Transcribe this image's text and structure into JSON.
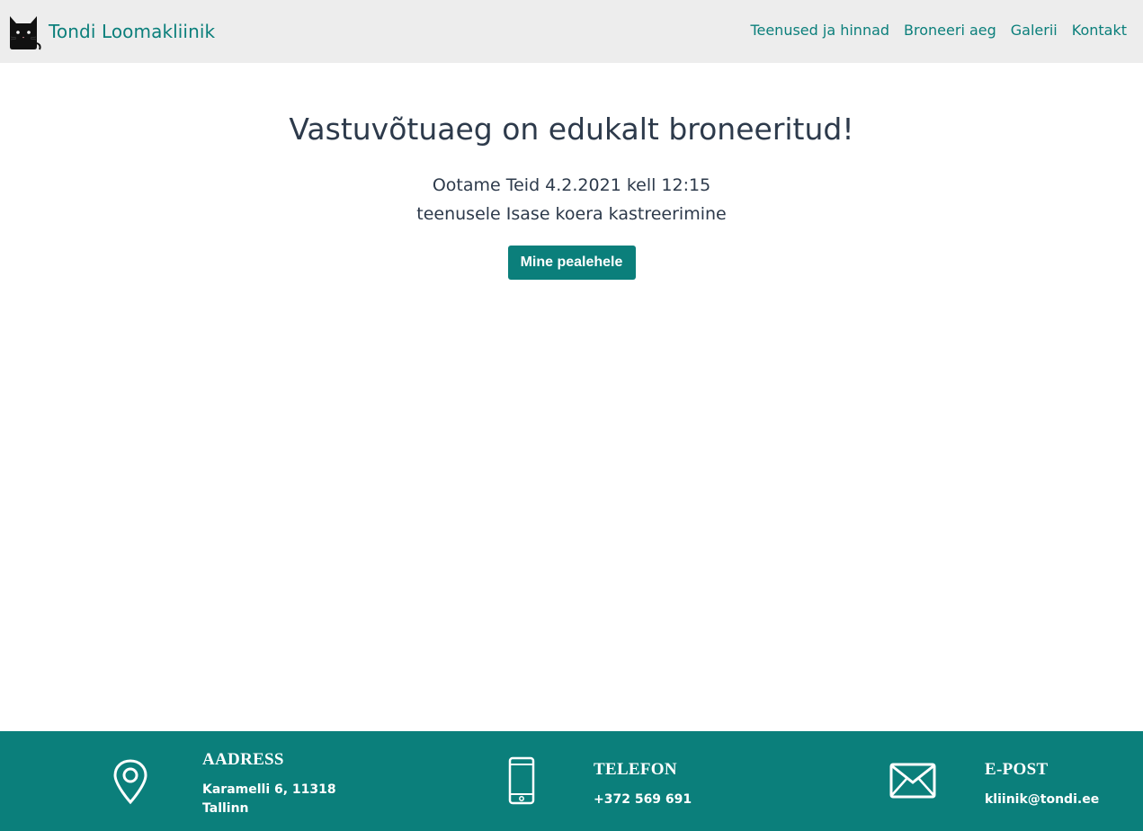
{
  "brand": {
    "name": "Tondi Loomakliinik"
  },
  "nav": {
    "items": [
      "Teenused ja hinnad",
      "Broneeri aeg",
      "Galerii",
      "Kontakt"
    ]
  },
  "confirmation": {
    "heading": "Vastuvõtuaeg on edukalt broneeritud!",
    "line1": "Ootame Teid 4.2.2021 kell 12:15",
    "line2": "teenusele Isase koera kastreerimine",
    "button_label": "Mine pealehele"
  },
  "footer": {
    "address": {
      "title": "AADRESS",
      "line1": "Karamelli 6, 11318",
      "line2": "Tallinn",
      "icon": "map-pin-icon"
    },
    "phone": {
      "title": "TELEFON",
      "value": "+372 569 691",
      "icon": "smartphone-icon"
    },
    "email": {
      "title": "E-POST",
      "value": "kliinik@tondi.ee",
      "icon": "envelope-icon"
    }
  },
  "colors": {
    "accent": "#0b7f7b",
    "navbar_bg": "#ededed",
    "text": "#2d3a4b"
  }
}
